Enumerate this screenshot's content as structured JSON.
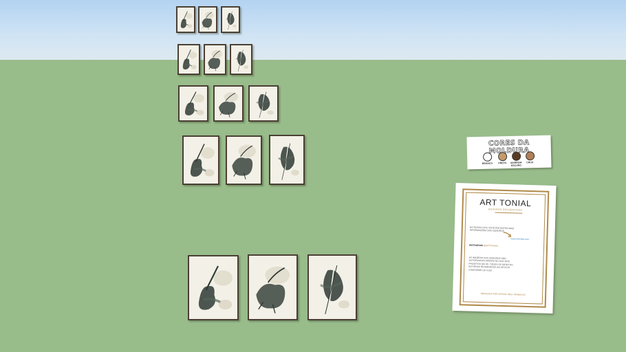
{
  "scene": {
    "description_free": true,
    "sky_color": "#cbe1f3",
    "ground_color": "#99bc8b",
    "frame_border_color": "#4a3f33",
    "frame_paper_color": "#f4f1e8",
    "ink_color": "#2e3a34"
  },
  "frame_colors_sign": {
    "title": "CORES DA MOLDURA",
    "swatches": [
      {
        "label": "BRANCO",
        "color": "#ffffff"
      },
      {
        "label": "PRETO",
        "color": "#c59a6a"
      },
      {
        "label": "MARROM ESCURO",
        "color": "#5b3a22"
      },
      {
        "label": "CRUA",
        "color": "#b08057"
      }
    ]
  },
  "poster": {
    "brand": "ART TONIAL",
    "subtitle": "QUADROS DECORATIVOS",
    "info": "NO NOSSO SITE VOCÊ ENCONTRA MAIS INFORMAÇÕES DOS QUADROS",
    "link": "www.arttonial.com",
    "instagram_label": "INSTAGRAM",
    "instagram_handle": "@ARTTONIAL",
    "rights": "AS IMAGENS DOS QUADROS SÃO AUTORIZADAS APENAS NO USO DOS PROJETOS EM 3D. TODOS OS DIREITOS AUTORAIS RESERVADOS AO ARTISTA CONFORME LEI 9.610",
    "footer": "OBRIGADA POR APOIAR MEU TRABALHO",
    "accent_color": "#b08a4a"
  }
}
